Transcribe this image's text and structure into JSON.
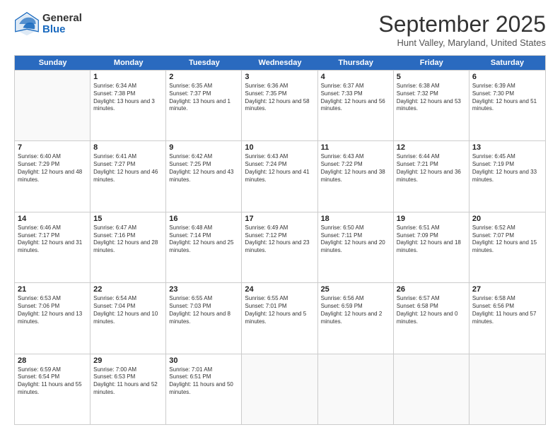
{
  "logo": {
    "general": "General",
    "blue": "Blue"
  },
  "title": "September 2025",
  "location": "Hunt Valley, Maryland, United States",
  "days": [
    "Sunday",
    "Monday",
    "Tuesday",
    "Wednesday",
    "Thursday",
    "Friday",
    "Saturday"
  ],
  "weeks": [
    [
      {
        "day": "",
        "empty": true
      },
      {
        "day": "1",
        "sunrise": "Sunrise: 6:34 AM",
        "sunset": "Sunset: 7:38 PM",
        "daylight": "Daylight: 13 hours and 3 minutes."
      },
      {
        "day": "2",
        "sunrise": "Sunrise: 6:35 AM",
        "sunset": "Sunset: 7:37 PM",
        "daylight": "Daylight: 13 hours and 1 minute."
      },
      {
        "day": "3",
        "sunrise": "Sunrise: 6:36 AM",
        "sunset": "Sunset: 7:35 PM",
        "daylight": "Daylight: 12 hours and 58 minutes."
      },
      {
        "day": "4",
        "sunrise": "Sunrise: 6:37 AM",
        "sunset": "Sunset: 7:33 PM",
        "daylight": "Daylight: 12 hours and 56 minutes."
      },
      {
        "day": "5",
        "sunrise": "Sunrise: 6:38 AM",
        "sunset": "Sunset: 7:32 PM",
        "daylight": "Daylight: 12 hours and 53 minutes."
      },
      {
        "day": "6",
        "sunrise": "Sunrise: 6:39 AM",
        "sunset": "Sunset: 7:30 PM",
        "daylight": "Daylight: 12 hours and 51 minutes."
      }
    ],
    [
      {
        "day": "7",
        "sunrise": "Sunrise: 6:40 AM",
        "sunset": "Sunset: 7:29 PM",
        "daylight": "Daylight: 12 hours and 48 minutes."
      },
      {
        "day": "8",
        "sunrise": "Sunrise: 6:41 AM",
        "sunset": "Sunset: 7:27 PM",
        "daylight": "Daylight: 12 hours and 46 minutes."
      },
      {
        "day": "9",
        "sunrise": "Sunrise: 6:42 AM",
        "sunset": "Sunset: 7:25 PM",
        "daylight": "Daylight: 12 hours and 43 minutes."
      },
      {
        "day": "10",
        "sunrise": "Sunrise: 6:43 AM",
        "sunset": "Sunset: 7:24 PM",
        "daylight": "Daylight: 12 hours and 41 minutes."
      },
      {
        "day": "11",
        "sunrise": "Sunrise: 6:43 AM",
        "sunset": "Sunset: 7:22 PM",
        "daylight": "Daylight: 12 hours and 38 minutes."
      },
      {
        "day": "12",
        "sunrise": "Sunrise: 6:44 AM",
        "sunset": "Sunset: 7:21 PM",
        "daylight": "Daylight: 12 hours and 36 minutes."
      },
      {
        "day": "13",
        "sunrise": "Sunrise: 6:45 AM",
        "sunset": "Sunset: 7:19 PM",
        "daylight": "Daylight: 12 hours and 33 minutes."
      }
    ],
    [
      {
        "day": "14",
        "sunrise": "Sunrise: 6:46 AM",
        "sunset": "Sunset: 7:17 PM",
        "daylight": "Daylight: 12 hours and 31 minutes."
      },
      {
        "day": "15",
        "sunrise": "Sunrise: 6:47 AM",
        "sunset": "Sunset: 7:16 PM",
        "daylight": "Daylight: 12 hours and 28 minutes."
      },
      {
        "day": "16",
        "sunrise": "Sunrise: 6:48 AM",
        "sunset": "Sunset: 7:14 PM",
        "daylight": "Daylight: 12 hours and 25 minutes."
      },
      {
        "day": "17",
        "sunrise": "Sunrise: 6:49 AM",
        "sunset": "Sunset: 7:12 PM",
        "daylight": "Daylight: 12 hours and 23 minutes."
      },
      {
        "day": "18",
        "sunrise": "Sunrise: 6:50 AM",
        "sunset": "Sunset: 7:11 PM",
        "daylight": "Daylight: 12 hours and 20 minutes."
      },
      {
        "day": "19",
        "sunrise": "Sunrise: 6:51 AM",
        "sunset": "Sunset: 7:09 PM",
        "daylight": "Daylight: 12 hours and 18 minutes."
      },
      {
        "day": "20",
        "sunrise": "Sunrise: 6:52 AM",
        "sunset": "Sunset: 7:07 PM",
        "daylight": "Daylight: 12 hours and 15 minutes."
      }
    ],
    [
      {
        "day": "21",
        "sunrise": "Sunrise: 6:53 AM",
        "sunset": "Sunset: 7:06 PM",
        "daylight": "Daylight: 12 hours and 13 minutes."
      },
      {
        "day": "22",
        "sunrise": "Sunrise: 6:54 AM",
        "sunset": "Sunset: 7:04 PM",
        "daylight": "Daylight: 12 hours and 10 minutes."
      },
      {
        "day": "23",
        "sunrise": "Sunrise: 6:55 AM",
        "sunset": "Sunset: 7:03 PM",
        "daylight": "Daylight: 12 hours and 8 minutes."
      },
      {
        "day": "24",
        "sunrise": "Sunrise: 6:55 AM",
        "sunset": "Sunset: 7:01 PM",
        "daylight": "Daylight: 12 hours and 5 minutes."
      },
      {
        "day": "25",
        "sunrise": "Sunrise: 6:56 AM",
        "sunset": "Sunset: 6:59 PM",
        "daylight": "Daylight: 12 hours and 2 minutes."
      },
      {
        "day": "26",
        "sunrise": "Sunrise: 6:57 AM",
        "sunset": "Sunset: 6:58 PM",
        "daylight": "Daylight: 12 hours and 0 minutes."
      },
      {
        "day": "27",
        "sunrise": "Sunrise: 6:58 AM",
        "sunset": "Sunset: 6:56 PM",
        "daylight": "Daylight: 11 hours and 57 minutes."
      }
    ],
    [
      {
        "day": "28",
        "sunrise": "Sunrise: 6:59 AM",
        "sunset": "Sunset: 6:54 PM",
        "daylight": "Daylight: 11 hours and 55 minutes."
      },
      {
        "day": "29",
        "sunrise": "Sunrise: 7:00 AM",
        "sunset": "Sunset: 6:53 PM",
        "daylight": "Daylight: 11 hours and 52 minutes."
      },
      {
        "day": "30",
        "sunrise": "Sunrise: 7:01 AM",
        "sunset": "Sunset: 6:51 PM",
        "daylight": "Daylight: 11 hours and 50 minutes."
      },
      {
        "day": "",
        "empty": true
      },
      {
        "day": "",
        "empty": true
      },
      {
        "day": "",
        "empty": true
      },
      {
        "day": "",
        "empty": true
      }
    ]
  ]
}
